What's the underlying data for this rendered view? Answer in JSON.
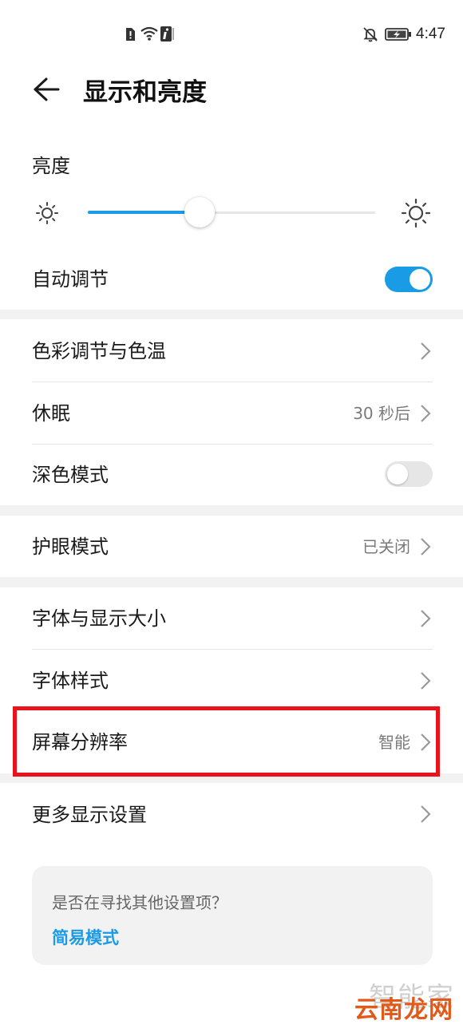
{
  "status_bar": {
    "time": "4:47"
  },
  "header": {
    "title": "显示和亮度"
  },
  "brightness": {
    "label": "亮度",
    "level": 0.39,
    "auto_label": "自动调节",
    "auto_enabled": true
  },
  "settings": {
    "color_temp": "色彩调节与色温",
    "sleep_label": "休眠",
    "sleep_value": "30 秒后",
    "dark_mode": "深色模式",
    "dark_mode_enabled": false,
    "eye_comfort_label": "护眼模式",
    "eye_comfort_value": "已关闭",
    "font_display_size": "字体与显示大小",
    "font_style": "字体样式",
    "resolution_label": "屏幕分辨率",
    "resolution_value": "智能",
    "more_display": "更多显示设置"
  },
  "suggestion": {
    "question": "是否在寻找其他设置项？",
    "link": "简易模式"
  },
  "watermark": {
    "top": "智能家",
    "bottom": "云南龙网"
  },
  "colors": {
    "accent": "#1a9be6",
    "highlight": "#e8141c",
    "watermark": "#e05a1a"
  }
}
